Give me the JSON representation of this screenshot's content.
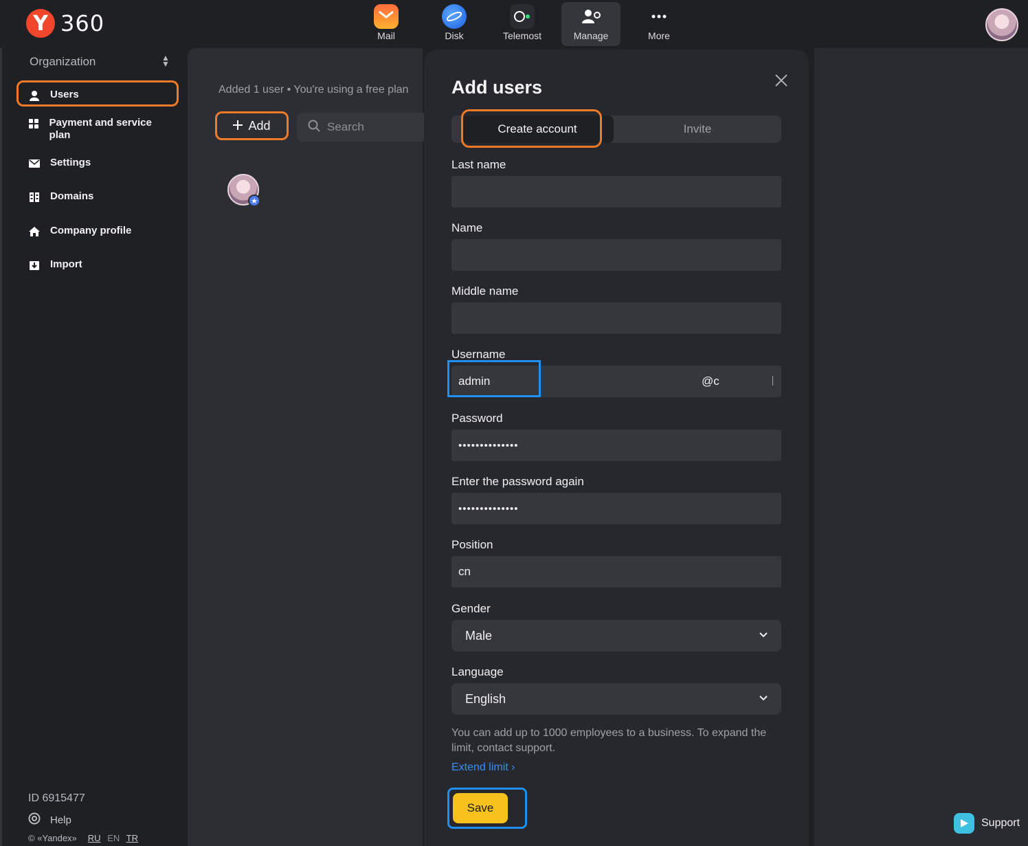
{
  "brand": {
    "logo_letter": "Y",
    "logo_text": "360"
  },
  "apps": [
    {
      "label": "Mail",
      "icon": "mail-icon"
    },
    {
      "label": "Disk",
      "icon": "disk-icon"
    },
    {
      "label": "Telemost",
      "icon": "telemost-icon"
    },
    {
      "label": "Manage",
      "icon": "manage-icon",
      "active": true
    },
    {
      "label": "More",
      "icon": "more-icon"
    }
  ],
  "sidebar": {
    "org_label": "Organization",
    "items": [
      {
        "label": "Users",
        "icon": "user-icon",
        "active": true
      },
      {
        "label": "Payment and service plan",
        "icon": "grid-icon"
      },
      {
        "label": "Settings",
        "icon": "mail-settings-icon"
      },
      {
        "label": "Domains",
        "icon": "domains-icon"
      },
      {
        "label": "Company profile",
        "icon": "home-icon"
      },
      {
        "label": "Import",
        "icon": "import-icon"
      }
    ],
    "org_id": "ID 6915477",
    "help": "Help",
    "copyright": "© «Yandex»",
    "languages": [
      "RU",
      "EN",
      "TR"
    ]
  },
  "main": {
    "info": "Added 1 user • You're using a free plan",
    "add_label": "Add",
    "search_placeholder": "Search"
  },
  "modal": {
    "title": "Add users",
    "tabs": [
      "Create account",
      "Invite"
    ],
    "fields": {
      "last_name": {
        "label": "Last name",
        "value": ""
      },
      "name": {
        "label": "Name",
        "value": ""
      },
      "middle_name": {
        "label": "Middle name",
        "value": ""
      },
      "username": {
        "label": "Username",
        "value": "admin",
        "domain": "@c"
      },
      "password": {
        "label": "Password",
        "value": "••••••••••••••"
      },
      "password_again": {
        "label": "Enter the password again",
        "value": "••••••••••••••"
      },
      "position": {
        "label": "Position",
        "value": "cn"
      },
      "gender": {
        "label": "Gender",
        "value": "Male"
      },
      "language": {
        "label": "Language",
        "value": "English"
      }
    },
    "note": "You can add up to 1000 employees to a business. To expand the limit, contact support.",
    "extend_link": "Extend limit",
    "save_label": "Save"
  },
  "support": {
    "label": "Support"
  },
  "colors": {
    "accent_yellow": "#f7c21b",
    "highlight_orange": "#f07a28",
    "highlight_blue": "#1f8ff0",
    "link_blue": "#3b8cf5"
  }
}
